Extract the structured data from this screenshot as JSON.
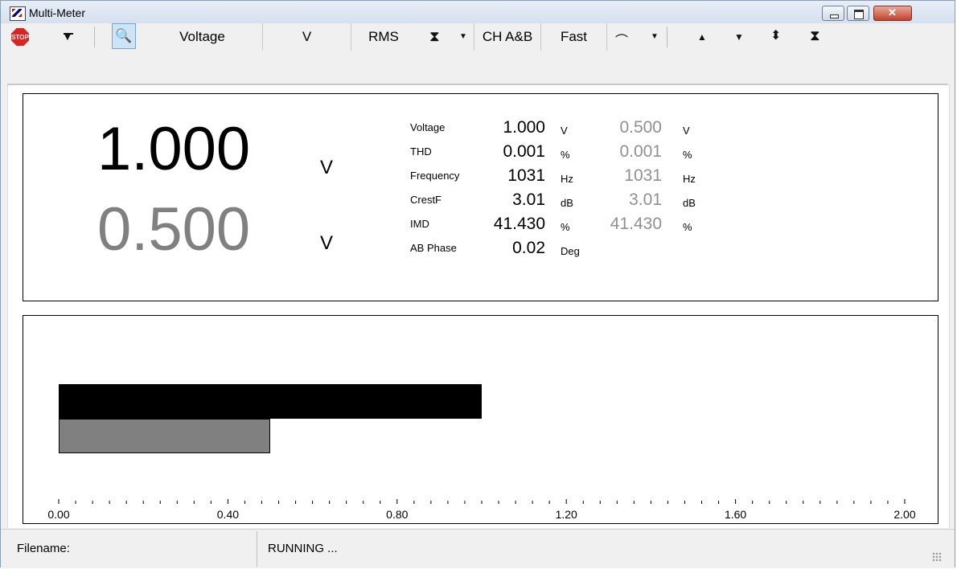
{
  "window": {
    "title": "Multi-Meter"
  },
  "toolbar": {
    "stop_label": "STOP",
    "mode": "Voltage",
    "unit": "V",
    "detector": "RMS",
    "channel": "CH A&B",
    "speed": "Fast"
  },
  "readout": {
    "main_a": "1.000",
    "main_b": "0.500",
    "main_unit_a": "V",
    "main_unit_b": "V",
    "rows": [
      {
        "label": "Voltage",
        "a": "1.000",
        "unit_a": "V",
        "b": "0.500",
        "unit_b": "V"
      },
      {
        "label": "THD",
        "a": "0.001",
        "unit_a": "%",
        "b": "0.001",
        "unit_b": "%"
      },
      {
        "label": "Frequency",
        "a": "1031",
        "unit_a": "Hz",
        "b": "1031",
        "unit_b": "Hz"
      },
      {
        "label": "CrestF",
        "a": "3.01",
        "unit_a": "dB",
        "b": "3.01",
        "unit_b": "dB"
      },
      {
        "label": "IMD",
        "a": "41.430",
        "unit_a": "%",
        "b": "41.430",
        "unit_b": "%"
      },
      {
        "label": "AB Phase",
        "a": "0.02",
        "unit_a": "Deg"
      }
    ]
  },
  "bargraph": {
    "values": {
      "a": 1.0,
      "b": 0.5
    },
    "ticks": [
      "0.00",
      "0.40",
      "0.80",
      "1.20",
      "1.60",
      "2.00"
    ],
    "min": 0,
    "max": 2.0,
    "colors": {
      "a": "#000000",
      "b": "#808080"
    }
  },
  "status": {
    "filename_label": "Filename:",
    "state": "RUNNING ..."
  }
}
